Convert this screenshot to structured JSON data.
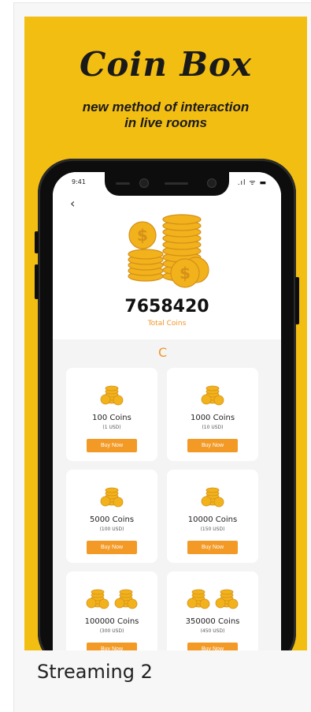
{
  "promo": {
    "title": "Coin Box",
    "subtitle_line1": "new method of interaction",
    "subtitle_line2": "in live rooms"
  },
  "status_bar": {
    "time": "9:41",
    "icons": ".ıl ᯤ ▬"
  },
  "app": {
    "back_glyph": "‹",
    "total_coins": "7658420",
    "total_coins_label": "Total Coins",
    "refresh_glyph": "C",
    "packages": [
      {
        "name": "100 Coins",
        "price": "(1 USD)",
        "button": "Buy Now"
      },
      {
        "name": "1000 Coins",
        "price": "(10 USD)",
        "button": "Buy Now"
      },
      {
        "name": "5000 Coins",
        "price": "(100 USD)",
        "button": "Buy Now"
      },
      {
        "name": "10000 Coins",
        "price": "(150 USD)",
        "button": "Buy Now"
      },
      {
        "name": "100000 Coins",
        "price": "(300 USD)",
        "button": "Buy Now"
      },
      {
        "name": "350000 Coins",
        "price": "(450 USD)",
        "button": "Buy Now"
      }
    ]
  },
  "caption": "Streaming 2",
  "colors": {
    "banner": "#f3be12",
    "accent": "#f39a26",
    "coin": "#f2b21c",
    "coin_dark": "#d4901a"
  }
}
